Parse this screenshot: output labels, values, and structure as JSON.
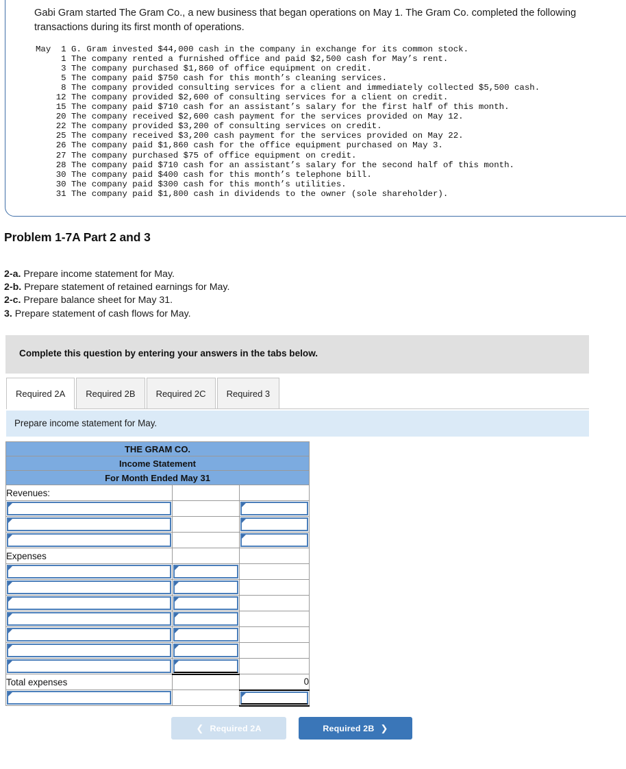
{
  "transactions_panel": {
    "intro": "Gabi Gram started The Gram Co., a new business that began operations on May 1. The Gram Co. completed the following transactions during its first month of operations.",
    "ledger_text": "May  1 G. Gram invested $44,000 cash in the company in exchange for its common stock.\n     1 The company rented a furnished office and paid $2,500 cash for May’s rent.\n     3 The company purchased $1,860 of office equipment on credit.\n     5 The company paid $750 cash for this month’s cleaning services.\n     8 The company provided consulting services for a client and immediately collected $5,500 cash.\n    12 The company provided $2,600 of consulting services for a client on credit.\n    15 The company paid $710 cash for an assistant’s salary for the first half of this month.\n    20 The company received $2,600 cash payment for the services provided on May 12.\n    22 The company provided $3,200 of consulting services on credit.\n    25 The company received $3,200 cash payment for the services provided on May 22.\n    26 The company paid $1,860 cash for the office equipment purchased on May 3.\n    27 The company purchased $75 of office equipment on credit.\n    28 The company paid $710 cash for an assistant’s salary for the second half of this month.\n    30 The company paid $400 cash for this month’s telephone bill.\n    30 The company paid $300 cash for this month’s utilities.\n    31 The company paid $1,800 cash in dividends to the owner (sole shareholder)."
  },
  "problem": {
    "title": "Problem 1-7A Part 2 and 3",
    "requirements": [
      {
        "label": "2-a.",
        "text": "Prepare income statement for May."
      },
      {
        "label": "2-b.",
        "text": "Prepare statement of retained earnings for May."
      },
      {
        "label": "2-c.",
        "text": "Prepare balance sheet for May 31."
      },
      {
        "label": "3.",
        "text": "Prepare statement of cash flows for May."
      }
    ]
  },
  "instruction_bar": {
    "text": "Complete this question by entering your answers in the tabs below."
  },
  "tabs": [
    {
      "label": "Required 2A",
      "active": true
    },
    {
      "label": "Required 2B",
      "active": false
    },
    {
      "label": "Required 2C",
      "active": false
    },
    {
      "label": "Required 3",
      "active": false
    }
  ],
  "prompt_bar": {
    "text": "Prepare income statement for May."
  },
  "statement": {
    "header_rows": [
      "THE GRAM CO.",
      "Income Statement",
      "For Month Ended May 31"
    ],
    "section_revenues_label": "Revenues:",
    "section_expenses_label": "Expenses",
    "total_expenses_label": "Total expenses",
    "total_expenses_value": "0",
    "revenue_input_rows": 3,
    "expense_input_rows": 7
  },
  "navigation": {
    "prev_label": "Required 2A",
    "next_label": "Required 2B",
    "prev_icon": "chevron-left-icon",
    "next_icon": "chevron-right-icon"
  },
  "colors": {
    "table_header_blue": "#7cabe0",
    "input_border_blue": "#4a7eba",
    "prompt_bar_blue": "#dbeaf7",
    "instruction_gray": "#e0e0e0",
    "next_button_blue": "#3a76b8",
    "prev_button_blue": "#cfe0f0",
    "panel_border": "#3f6fa8"
  }
}
